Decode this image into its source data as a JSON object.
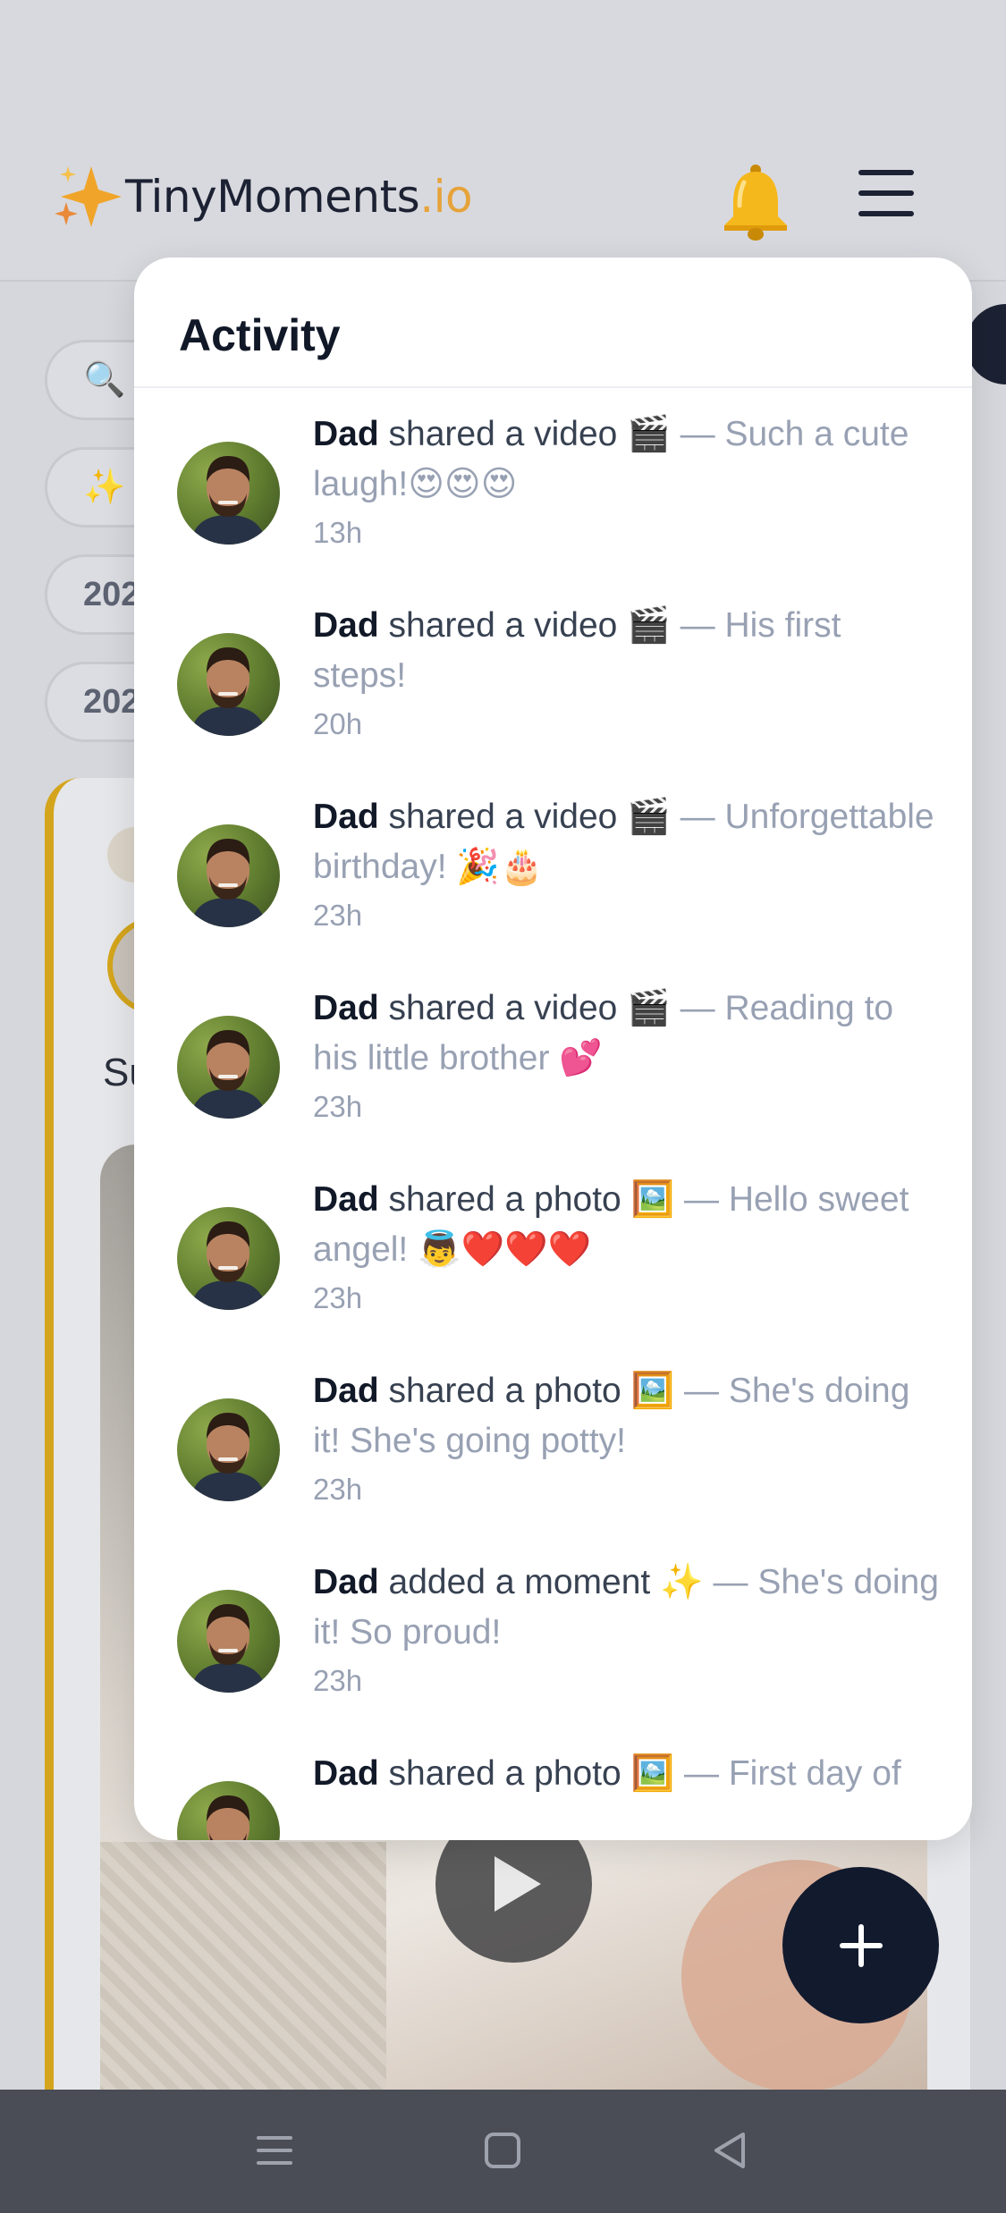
{
  "header": {
    "brand_name": "TinyMoments",
    "brand_tld": ".io",
    "icons": [
      "sparkle-logo-icon",
      "bell-icon",
      "hamburger-menu-icon"
    ]
  },
  "background": {
    "filters": [
      "🔍",
      "✨",
      "202",
      "202"
    ],
    "card_caption": "Su"
  },
  "activity": {
    "title": "Activity",
    "items": [
      {
        "actor": "Dad",
        "action": "shared a video",
        "emoji": "🎬",
        "caption": "Such a cute laugh!😍😍😍",
        "time": "13h"
      },
      {
        "actor": "Dad",
        "action": "shared a video",
        "emoji": "🎬",
        "caption": "His first steps!",
        "time": "20h"
      },
      {
        "actor": "Dad",
        "action": "shared a video",
        "emoji": "🎬",
        "caption": "Unforgettable birthday! 🎉🎂",
        "time": "23h"
      },
      {
        "actor": "Dad",
        "action": "shared a video",
        "emoji": "🎬",
        "caption": "Reading to his little brother 💕",
        "time": "23h"
      },
      {
        "actor": "Dad",
        "action": "shared a photo",
        "emoji": "🖼️",
        "caption": "Hello sweet angel! 👼❤️❤️❤️",
        "time": "23h"
      },
      {
        "actor": "Dad",
        "action": "shared a photo",
        "emoji": "🖼️",
        "caption": "She's doing it! She's going potty!",
        "time": "23h"
      },
      {
        "actor": "Dad",
        "action": "added a moment",
        "emoji": "✨",
        "caption": "She's doing it! So proud!",
        "time": "23h"
      },
      {
        "actor": "Dad",
        "action": "shared a photo",
        "emoji": "🖼️",
        "caption": "First day of",
        "time": ""
      }
    ]
  },
  "colors": {
    "accent_gold": "#d4a51c",
    "dark_navy": "#121a2e",
    "muted_text": "#98a1b3"
  }
}
